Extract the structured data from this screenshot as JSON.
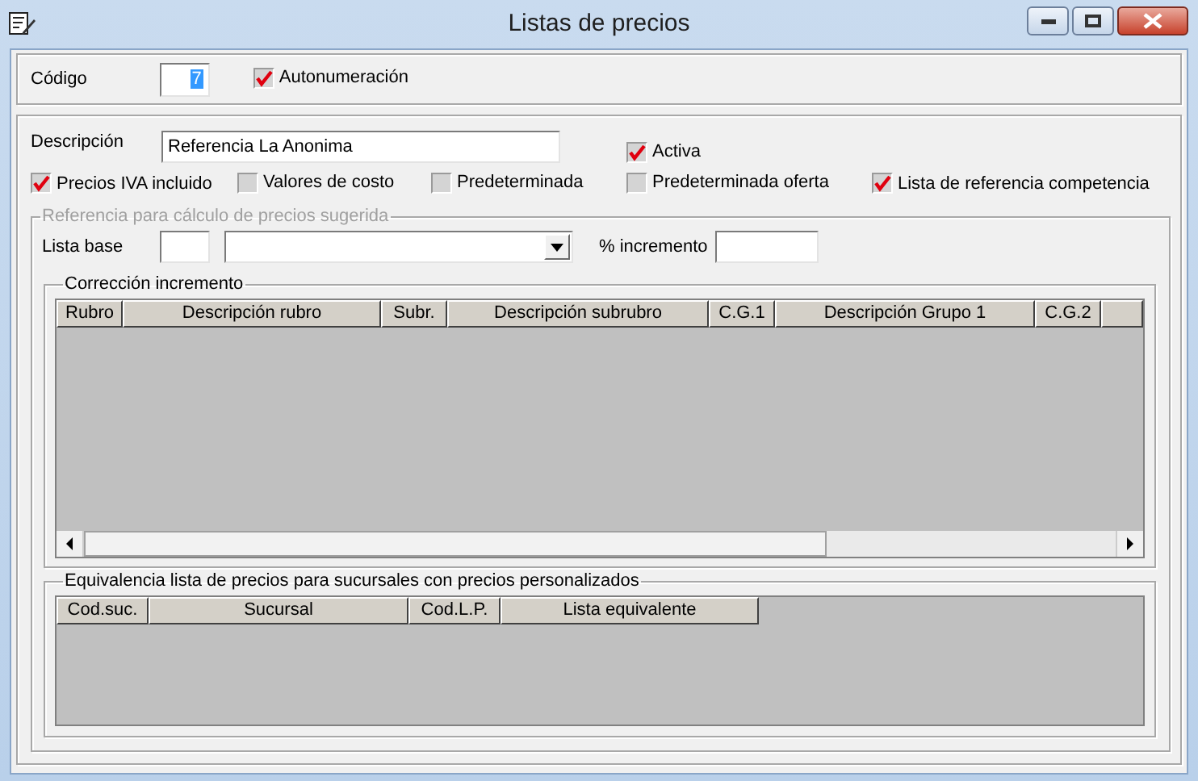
{
  "window": {
    "title": "Listas de precios"
  },
  "codigo": {
    "label": "Código",
    "value": "7",
    "value_selected": true
  },
  "autonumeracion": {
    "label": "Autonumeración",
    "checked": true
  },
  "descripcion": {
    "label": "Descripción",
    "value": "Referencia La Anonima"
  },
  "activa": {
    "label": "Activa",
    "checked": true
  },
  "options": [
    {
      "label": "Precios IVA incluido",
      "checked": true
    },
    {
      "label": "Valores de costo",
      "checked": false
    },
    {
      "label": "Predeterminada",
      "checked": false
    },
    {
      "label": "Predeterminada oferta",
      "checked": false
    },
    {
      "label": "Lista de referencia competencia",
      "checked": true
    }
  ],
  "referencia": {
    "legend": "Referencia para cálculo de precios sugerida",
    "disabled": true,
    "lista_base_label": "Lista base",
    "incremento_label": "% incremento"
  },
  "correccion": {
    "legend": "Corrección incremento",
    "columns": [
      "Rubro",
      "Descripción rubro",
      "Subr.",
      "Descripción subrubro",
      "C.G.1",
      "Descripción Grupo 1",
      "C.G.2"
    ]
  },
  "equivalencia": {
    "legend": "Equivalencia lista de precios para sucursales con precios personalizados",
    "columns": [
      "Cod.suc.",
      "Sucursal",
      "Cod.L.P.",
      "Lista equivalente"
    ]
  }
}
